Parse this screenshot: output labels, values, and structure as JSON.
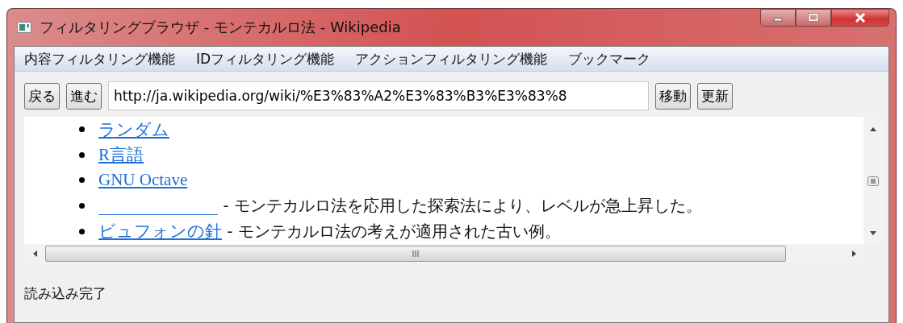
{
  "window": {
    "title": "フィルタリングブラウザ - モンテカルロ法 - Wikipedia"
  },
  "menu": [
    "内容フィルタリング機能",
    "IDフィルタリング機能",
    "アクションフィルタリング機能",
    "ブックマーク"
  ],
  "toolbar": {
    "back": "戻る",
    "forward": "進む",
    "url": "http://ja.wikipedia.org/wiki/%E3%83%A2%E3%83%B3%E3%83%8",
    "go": "移動",
    "reload": "更新"
  },
  "page": {
    "items": [
      {
        "kind": "link",
        "link": "ランダム"
      },
      {
        "kind": "link",
        "link": "R言語"
      },
      {
        "kind": "link",
        "link": "GNU Octave"
      },
      {
        "kind": "blank",
        "description": " - モンテカルロ法を応用した探索法により、レベルが急上昇した。"
      },
      {
        "kind": "link",
        "link": "ビュフォンの針",
        "description": " - モンテカルロ法の考えが適用された古い例。"
      }
    ]
  },
  "status_bar": "読み込み完了"
}
